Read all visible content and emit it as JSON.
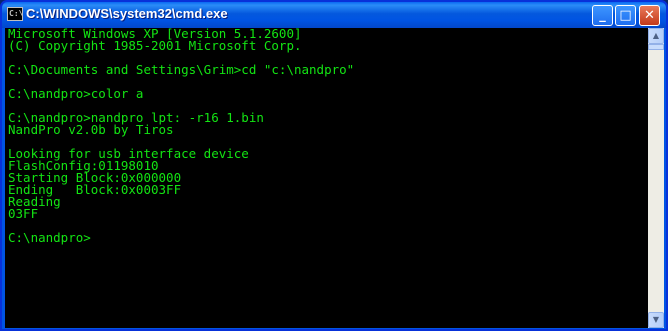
{
  "window": {
    "title": "C:\\WINDOWS\\system32\\cmd.exe",
    "icon_label": "C:\\"
  },
  "controls": {
    "minimize": "_",
    "maximize": "□",
    "close": "✕"
  },
  "console": {
    "lines": [
      "Microsoft Windows XP [Version 5.1.2600]",
      "(C) Copyright 1985-2001 Microsoft Corp.",
      "",
      "C:\\Documents and Settings\\Grim>cd \"c:\\nandpro\"",
      "",
      "C:\\nandpro>color a",
      "",
      "C:\\nandpro>nandpro lpt: -r16 1.bin",
      "NandPro v2.0b by Tiros",
      "",
      "Looking for usb interface device",
      "FlashConfig:01198010",
      "Starting Block:0x000000",
      "Ending   Block:0x0003FF",
      "Reading",
      "03FF",
      "",
      "C:\\nandpro>"
    ]
  },
  "scrollbar": {
    "up_arrow": "▲",
    "down_arrow": "▼"
  },
  "colors": {
    "console_text": "#13e413",
    "console_bg": "#000000",
    "titlebar": "#0054e3"
  }
}
